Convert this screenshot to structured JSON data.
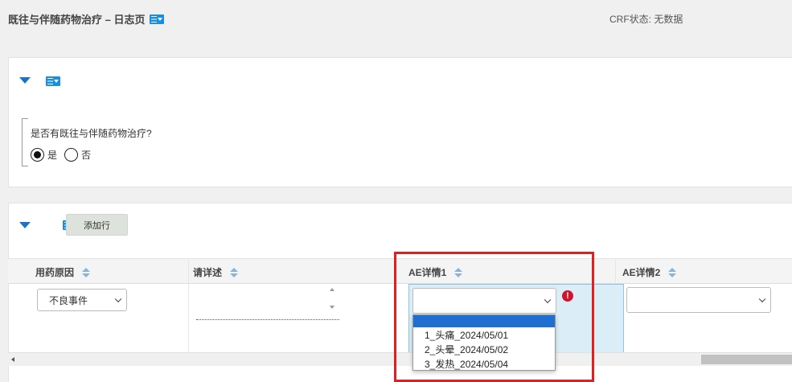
{
  "header": {
    "title": "既往与伴随药物治疗 – 日志页",
    "crf_status": "CRF状态: 无数据"
  },
  "section1": {
    "question": "是否有既往与伴随药物治疗?",
    "options": [
      {
        "label": "是",
        "selected": true
      },
      {
        "label": "否",
        "selected": false
      }
    ]
  },
  "section2": {
    "add_row_label": "添加行",
    "columns": [
      {
        "label": "用药原因"
      },
      {
        "label": "请详述"
      },
      {
        "label": "AE详情1"
      },
      {
        "label": "AE详情2"
      }
    ],
    "row": {
      "reason_value": "不良事件",
      "detail_value": "",
      "ae1_value": "",
      "ae2_value": ""
    },
    "ae1_dropdown": {
      "options": [
        "",
        "1_头痛_2024/05/01",
        "2_头晕_2024/05/02",
        "3_发热_2024/05/04"
      ],
      "highlighted_index": 0
    },
    "error_symbol": "!"
  },
  "colors": {
    "accent": "#1a73c7",
    "highlight_border": "#e02020",
    "error": "#d0142c",
    "selected_option": "#1e6fcf"
  }
}
